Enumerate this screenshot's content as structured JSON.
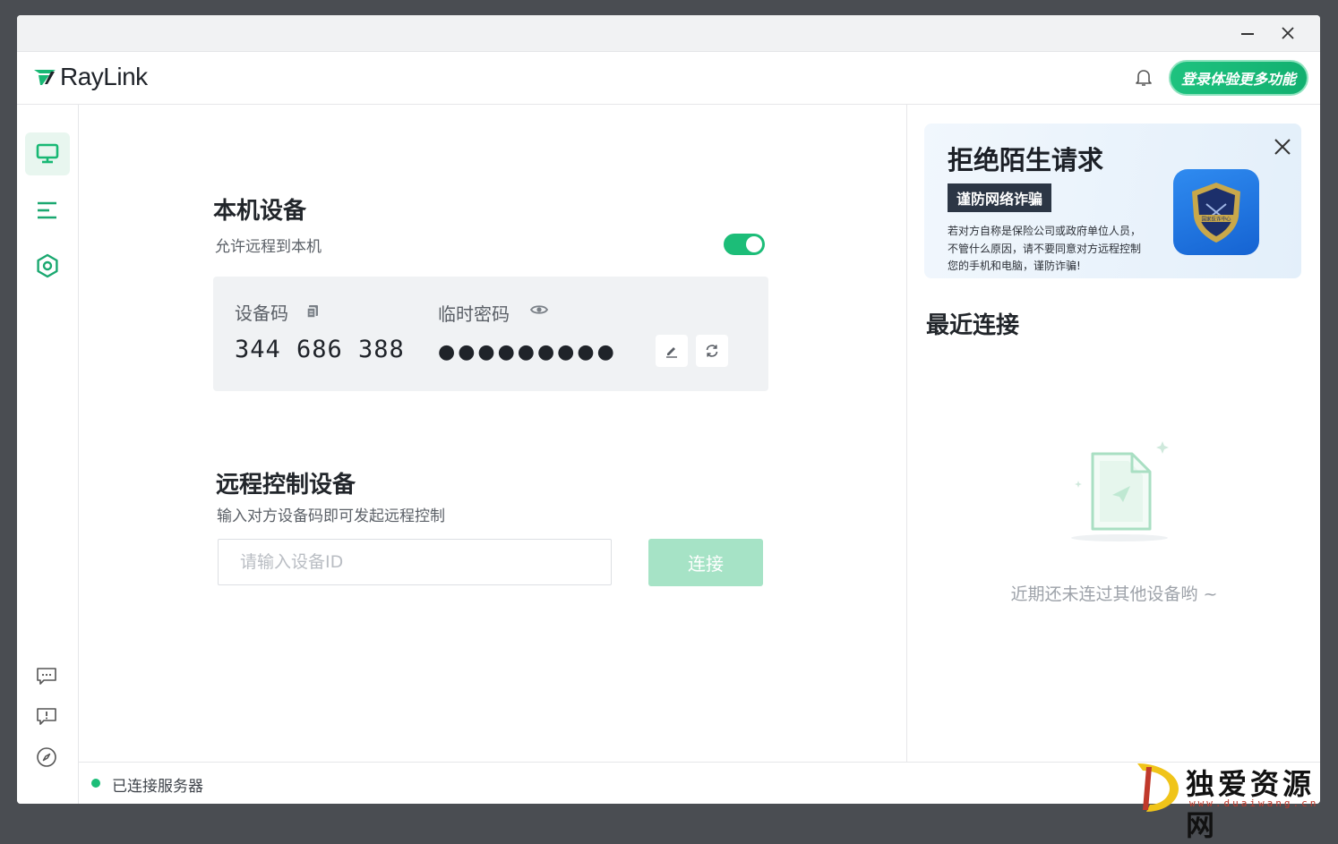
{
  "app": {
    "brand": "RayLink",
    "login_button": "登录体验更多功能"
  },
  "sidebar": {
    "items": [
      {
        "name": "monitor-icon",
        "active": true
      },
      {
        "name": "list-icon",
        "active": false
      },
      {
        "name": "settings-icon",
        "active": false
      }
    ],
    "bottom": [
      "chat-icon",
      "feedback-icon",
      "compass-icon"
    ]
  },
  "local_device": {
    "title": "本机设备",
    "allow_remote_label": "允许远程到本机",
    "allow_remote_enabled": true,
    "device_code_label": "设备码",
    "device_code": "344 686 388",
    "temp_password_label": "临时密码",
    "temp_password_masked": "●●●●●●●●●"
  },
  "remote_control": {
    "title": "远程控制设备",
    "subtitle": "输入对方设备码即可发起远程控制",
    "input_placeholder": "请输入设备ID",
    "input_value": "",
    "connect_button": "连接"
  },
  "banner": {
    "title": "拒绝陌生请求",
    "tag": "谨防网络诈骗",
    "text": "若对方自称是保险公司或政府单位人员，不管什么原因，请不要同意对方远程控制您的手机和电脑，谨防诈骗!",
    "badge_text": "国家反诈中心"
  },
  "recent": {
    "title": "最近连接",
    "empty_text": "近期还未连过其他设备哟 ~"
  },
  "status": {
    "text": "已连接服务器",
    "color": "#1cbd78"
  },
  "watermark": {
    "text": "独爱资源网",
    "url": "www.duaiwang.cn"
  },
  "colors": {
    "accent": "#1cbd78",
    "connect_disabled": "#a6e3c6"
  }
}
